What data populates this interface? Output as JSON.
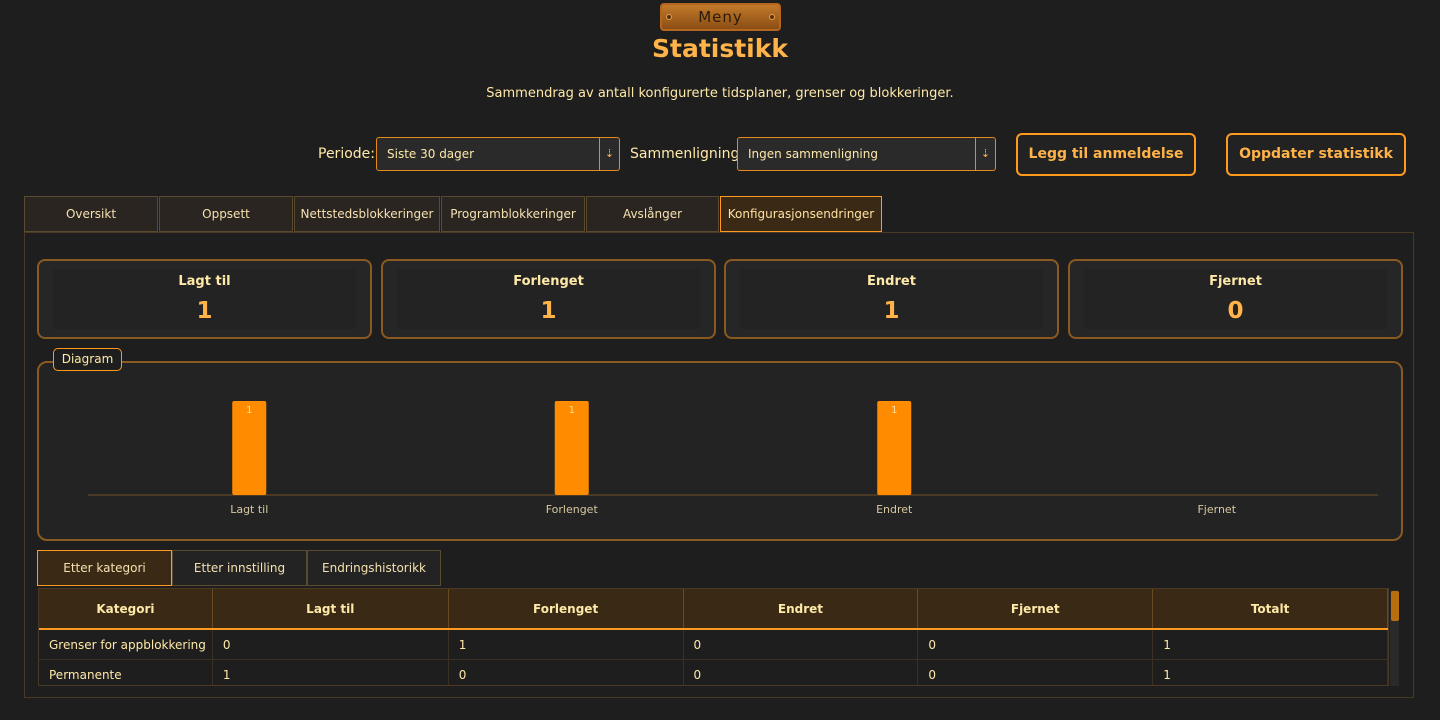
{
  "menu": {
    "label": "Meny"
  },
  "page": {
    "title": "Statistikk",
    "subtitle": "Sammendrag av antall konfigurerte tidsplaner, grenser og blokkeringer."
  },
  "filters": {
    "period_label": "Periode:",
    "period_value": "Siste 30 dager",
    "comparison_label": "Sammenligning:",
    "comparison_value": "Ingen sammenligning"
  },
  "actions": {
    "add_review": "Legg til anmeldelse",
    "refresh": "Oppdater statistikk"
  },
  "tabs": [
    {
      "label": "Oversikt",
      "active": false
    },
    {
      "label": "Oppsett",
      "active": false
    },
    {
      "label": "Nettstedsblokkeringer",
      "active": false
    },
    {
      "label": "Programblokkeringer",
      "active": false
    },
    {
      "label": "Avslånger",
      "active": false
    },
    {
      "label": "Konfigurasjonsendringer",
      "active": true
    }
  ],
  "cards": [
    {
      "label": "Lagt til",
      "value": "1"
    },
    {
      "label": "Forlenget",
      "value": "1"
    },
    {
      "label": "Endret",
      "value": "1"
    },
    {
      "label": "Fjernet",
      "value": "0"
    }
  ],
  "diagram_label": "Diagram",
  "chart_data": {
    "type": "bar",
    "categories": [
      "Lagt til",
      "Forlenget",
      "Endret",
      "Fjernet"
    ],
    "values": [
      1,
      1,
      1,
      0
    ],
    "title": "",
    "xlabel": "",
    "ylabel": "",
    "bar_color": "#ff8c00",
    "grid": false
  },
  "subtabs": [
    {
      "label": "Etter kategori",
      "active": true
    },
    {
      "label": "Etter innstilling",
      "active": false
    },
    {
      "label": "Endringshistorikk",
      "active": false
    }
  ],
  "table": {
    "headers": [
      "Kategori",
      "Lagt til",
      "Forlenget",
      "Endret",
      "Fjernet",
      "Totalt"
    ],
    "rows": [
      [
        "Grenser for appblokkering",
        "0",
        "1",
        "0",
        "0",
        "1"
      ],
      [
        "Permanente appblokkeringer",
        "1",
        "0",
        "0",
        "0",
        "1"
      ]
    ]
  },
  "colors": {
    "accent": "#ff9a1f",
    "background": "#1e1e1e",
    "text": "#ffe9a8"
  }
}
